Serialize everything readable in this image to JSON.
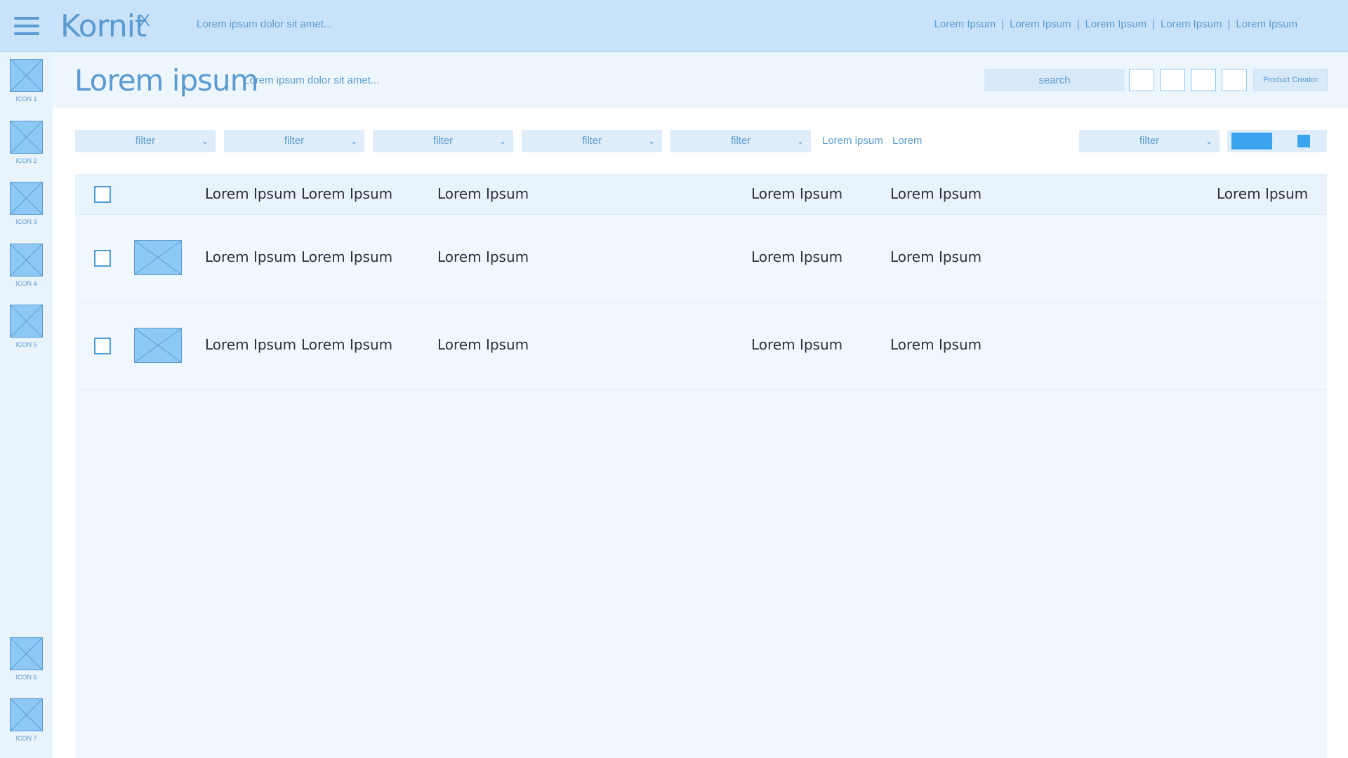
{
  "topbar": {
    "logo": "Kornit",
    "logo_sup": "X",
    "tagline": "Lorem ipsum dolor sit amet...",
    "links": [
      "Lorem Ipsum",
      "Lorem Ipsum",
      "Lorem Ipsum",
      "Lorem Ipsum",
      "Lorem Ipsum"
    ],
    "separator": "|"
  },
  "sidebar": {
    "items": [
      {
        "label": "ICON 1"
      },
      {
        "label": "ICON 2"
      },
      {
        "label": "ICON 3"
      },
      {
        "label": "ICON 4"
      },
      {
        "label": "ICON 5"
      },
      {
        "label": "ICON 6"
      },
      {
        "label": "ICON 7"
      }
    ]
  },
  "header": {
    "title": "Lorem ipsum",
    "subtitle": "Lorem ipsum dolor sit amet...",
    "search_placeholder": "search",
    "product_creator": "Product Creator"
  },
  "filters": {
    "items": [
      "filter",
      "filter",
      "filter",
      "filter",
      "filter",
      "filter"
    ],
    "links": [
      "Lorem ipsum",
      "Lorem"
    ]
  },
  "table": {
    "headers": [
      "Lorem Ipsum",
      "Lorem Ipsum",
      "Lorem Ipsum",
      "Lorem Ipsum",
      "Lorem Ipsum",
      "Lorem Ipsum"
    ],
    "rows": [
      [
        "Lorem Ipsum",
        "Lorem Ipsum",
        "Lorem Ipsum",
        "Lorem Ipsum",
        "Lorem Ipsum"
      ],
      [
        "Lorem Ipsum",
        "Lorem Ipsum",
        "Lorem Ipsum",
        "Lorem Ipsum",
        "Lorem Ipsum"
      ]
    ]
  },
  "colors": {
    "topbar_bg": "#c8e3f9",
    "accent": "#5b9bd1",
    "placeholder_fill": "#8ec9f5",
    "toggle_active": "#3aa3f0"
  }
}
